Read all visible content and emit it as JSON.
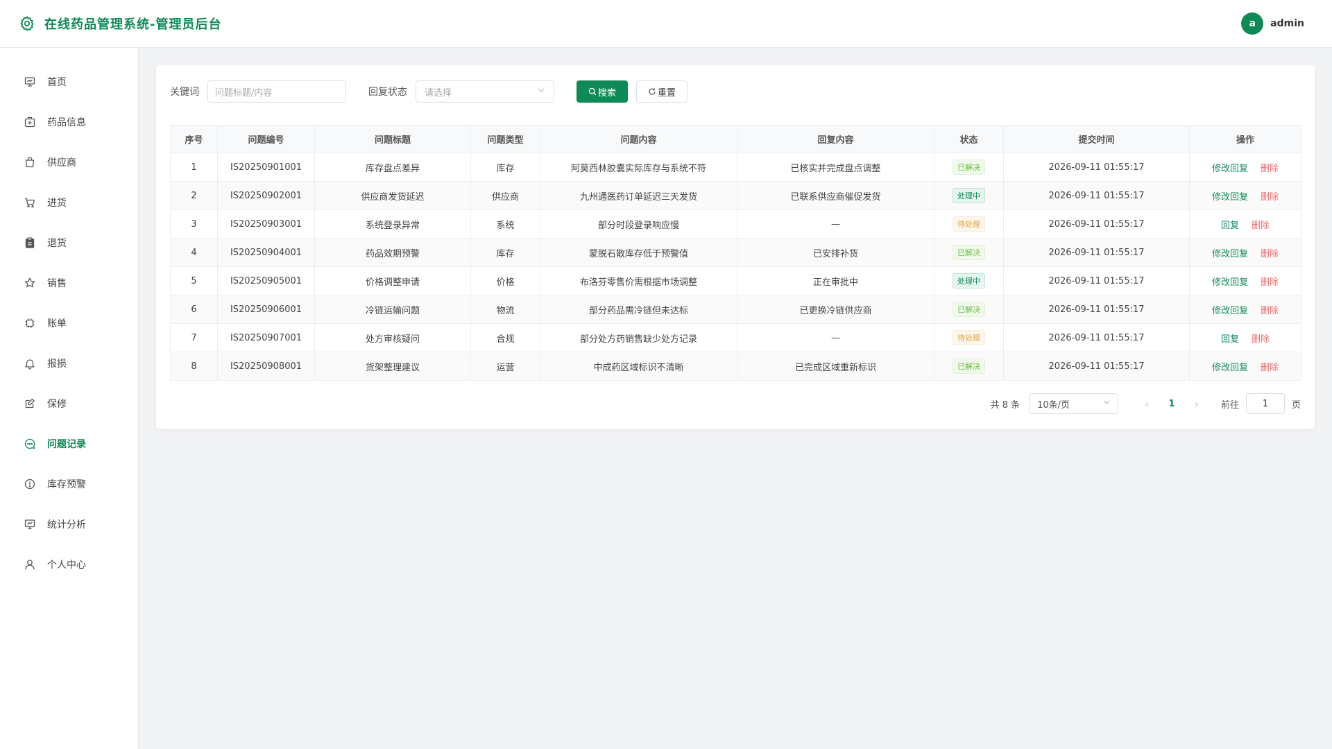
{
  "header": {
    "title": "在线药品管理系统-管理员后台",
    "user_initial": "a",
    "user_name": "admin"
  },
  "colors": {
    "accent": "#0e8a57",
    "danger": "#f56c6c",
    "success": "#67c23a",
    "warning": "#e6a23c"
  },
  "sidebar": {
    "active_index": 9,
    "items": [
      {
        "label": "首页",
        "icon": "home-monitor-icon"
      },
      {
        "label": "药品信息",
        "icon": "medicine-box-icon"
      },
      {
        "label": "供应商",
        "icon": "shopping-bag-icon"
      },
      {
        "label": "进货",
        "icon": "cart-icon"
      },
      {
        "label": "退货",
        "icon": "clipboard-icon"
      },
      {
        "label": "销售",
        "icon": "star-icon"
      },
      {
        "label": "账单",
        "icon": "chip-icon"
      },
      {
        "label": "报损",
        "icon": "bell-icon"
      },
      {
        "label": "保修",
        "icon": "edit-note-icon"
      },
      {
        "label": "问题记录",
        "icon": "chat-dot-icon"
      },
      {
        "label": "库存预警",
        "icon": "warning-circle-icon"
      },
      {
        "label": "统计分析",
        "icon": "monitor-chart-icon"
      },
      {
        "label": "个人中心",
        "icon": "user-icon"
      }
    ]
  },
  "filters": {
    "keyword_label": "关键词",
    "keyword_placeholder": "问题标题/内容",
    "status_label": "回复状态",
    "status_placeholder": "请选择",
    "search_label": "搜索",
    "reset_label": "重置"
  },
  "table": {
    "columns": [
      "序号",
      "问题编号",
      "问题标题",
      "问题类型",
      "问题内容",
      "回复内容",
      "状态",
      "提交时间",
      "操作"
    ],
    "rows": [
      {
        "no": "1",
        "code": "IS20250901001",
        "title": "库存盘点差异",
        "type": "库存",
        "content": "阿莫西林胶囊实际库存与系统不符",
        "reply": "已核实并完成盘点调整",
        "status": "已解决",
        "status_kind": "done",
        "time": "2026-09-11 01:55:17",
        "edit_label": "修改回复",
        "delete_label": "删除"
      },
      {
        "no": "2",
        "code": "IS20250902001",
        "title": "供应商发货延迟",
        "type": "供应商",
        "content": "九州通医药订单延迟三天发货",
        "reply": "已联系供应商催促发货",
        "status": "处理中",
        "status_kind": "proc",
        "time": "2026-09-11 01:55:17",
        "edit_label": "修改回复",
        "delete_label": "删除"
      },
      {
        "no": "3",
        "code": "IS20250903001",
        "title": "系统登录异常",
        "type": "系统",
        "content": "部分时段登录响应慢",
        "reply": "—",
        "status": "待处理",
        "status_kind": "wait",
        "time": "2026-09-11 01:55:17",
        "edit_label": "回复",
        "delete_label": "删除"
      },
      {
        "no": "4",
        "code": "IS20250904001",
        "title": "药品效期预警",
        "type": "库存",
        "content": "蒙脱石散库存低于预警值",
        "reply": "已安排补货",
        "status": "已解决",
        "status_kind": "done",
        "time": "2026-09-11 01:55:17",
        "edit_label": "修改回复",
        "delete_label": "删除"
      },
      {
        "no": "5",
        "code": "IS20250905001",
        "title": "价格调整申请",
        "type": "价格",
        "content": "布洛芬零售价需根据市场调整",
        "reply": "正在审批中",
        "status": "处理中",
        "status_kind": "proc",
        "time": "2026-09-11 01:55:17",
        "edit_label": "修改回复",
        "delete_label": "删除"
      },
      {
        "no": "6",
        "code": "IS20250906001",
        "title": "冷链运输问题",
        "type": "物流",
        "content": "部分药品需冷链但未达标",
        "reply": "已更换冷链供应商",
        "status": "已解决",
        "status_kind": "done",
        "time": "2026-09-11 01:55:17",
        "edit_label": "修改回复",
        "delete_label": "删除"
      },
      {
        "no": "7",
        "code": "IS20250907001",
        "title": "处方审核疑问",
        "type": "合规",
        "content": "部分处方药销售缺少处方记录",
        "reply": "—",
        "status": "待处理",
        "status_kind": "wait",
        "time": "2026-09-11 01:55:17",
        "edit_label": "回复",
        "delete_label": "删除"
      },
      {
        "no": "8",
        "code": "IS20250908001",
        "title": "货架整理建议",
        "type": "运营",
        "content": "中成药区域标识不清晰",
        "reply": "已完成区域重新标识",
        "status": "已解决",
        "status_kind": "done",
        "time": "2026-09-11 01:55:17",
        "edit_label": "修改回复",
        "delete_label": "删除"
      }
    ]
  },
  "pagination": {
    "total_text": "共 8 条",
    "page_size": "10条/页",
    "current_page": "1",
    "goto_label": "前往",
    "goto_value": "1",
    "page_suffix": "页"
  }
}
